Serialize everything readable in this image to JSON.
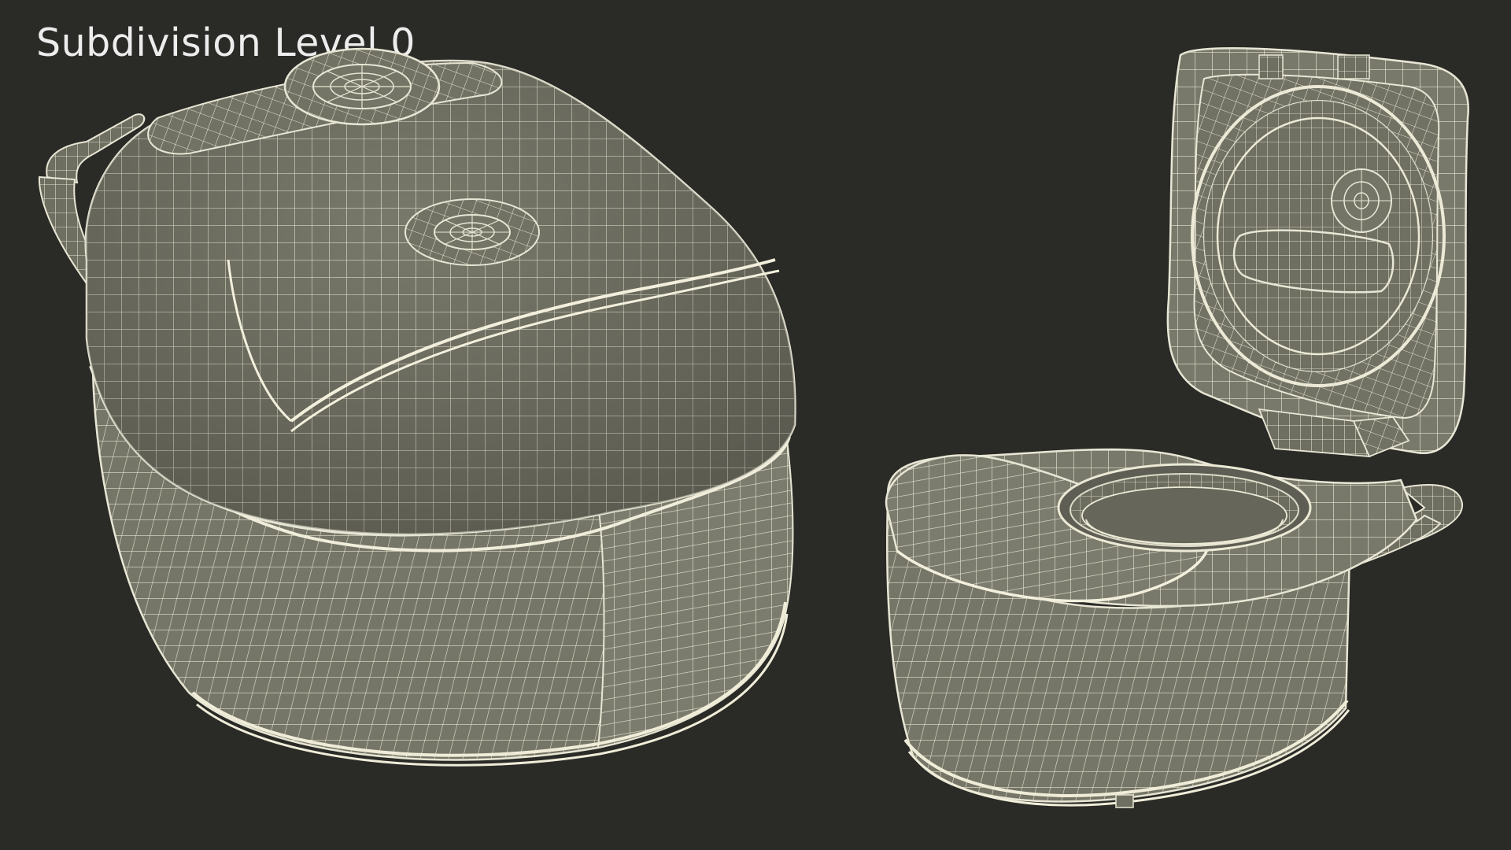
{
  "caption": {
    "text": "Subdivision Level 0"
  },
  "colors": {
    "background": "#2a2a27",
    "mesh_fill": "#7a7a6c",
    "mesh_fill_dark": "#656558",
    "wire": "#e8e6d4",
    "caption_text": "#ededed"
  },
  "objects": [
    {
      "name": "rice-cooker-closed",
      "view": "three-quarter, lid closed, handle raised"
    },
    {
      "name": "rice-cooker-open",
      "view": "three-quarter, lid open showing inner pot and steam valve"
    }
  ]
}
